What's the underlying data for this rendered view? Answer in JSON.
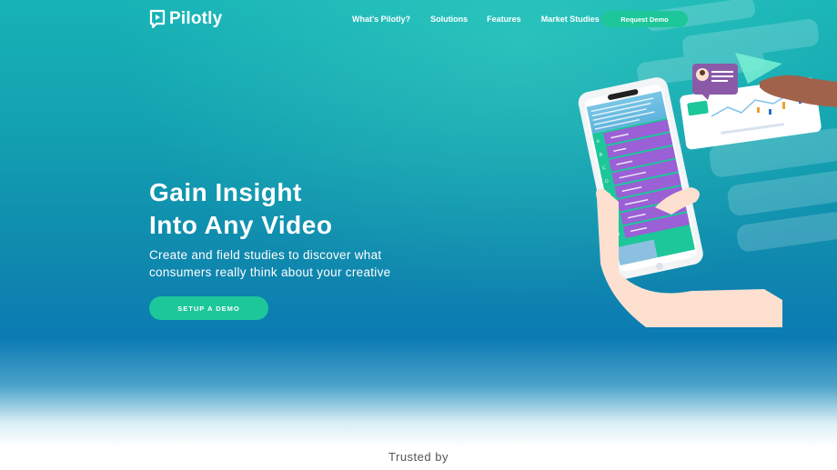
{
  "brand": {
    "name": "Pilotly"
  },
  "nav": {
    "items": [
      "What's Pilotly?",
      "Solutions",
      "Features",
      "Market Studies"
    ],
    "cta": "Request Demo"
  },
  "hero": {
    "headline_line1": "Gain Insight",
    "headline_line2": "Into Any Video",
    "subtext": "Create and field studies to discover what consumers really think about your creative",
    "cta": "SETUP A DEMO"
  },
  "trusted": {
    "label": "Trusted by"
  },
  "phone": {
    "option_letters": [
      "A",
      "B",
      "C",
      "D",
      "E",
      "F",
      "G",
      "H"
    ]
  },
  "colors": {
    "accent_green": "#1dc79a",
    "hero_teal": "#17b3b6",
    "hero_blue": "#0b7bb3",
    "option_purple": "#9b5fd6"
  }
}
